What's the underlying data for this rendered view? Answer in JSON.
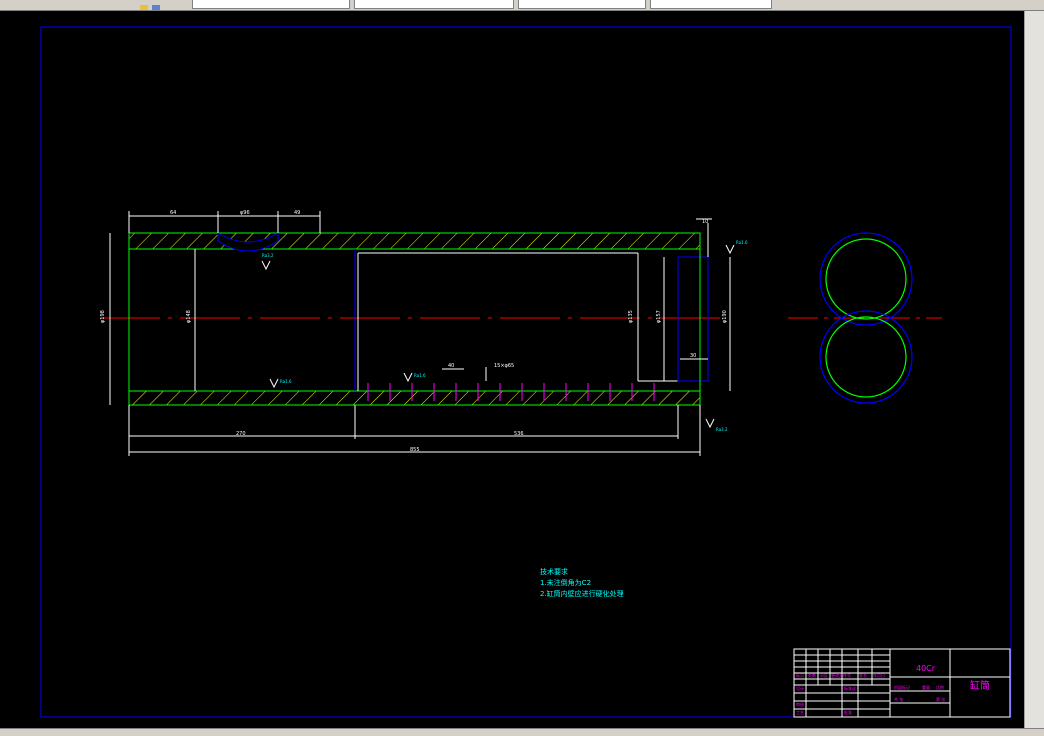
{
  "toolbar": {
    "icons": [
      "layer-state-icon",
      "layer-properties-icon"
    ],
    "dropdown_values": [
      "",
      "",
      "",
      "",
      ""
    ]
  },
  "drawing": {
    "dimensions": {
      "d_64": "64",
      "d_phi96": "φ96",
      "d_49": "49",
      "d_10": "10",
      "d_phi198": "φ198",
      "d_phi148": "φ148",
      "d_phi135_right": "φ135",
      "d_phi190": "φ190",
      "d_phi157": "φ157",
      "d_30": "30",
      "d_40": "40",
      "d_thread": "15×φ65",
      "d_270": "270",
      "d_536": "536",
      "d_855": "855"
    },
    "roughness": {
      "r1": "Ra3.2",
      "r2": "Ra1.6",
      "r3": "Ra1.6",
      "r4": "Ra1.6",
      "r5": "Ra3.2"
    },
    "notes": {
      "title": "技术要求",
      "line1": "1.未注倒角为C2",
      "line2": "2.缸筒内壁应进行硬化处理"
    },
    "title_block": {
      "material": "40Cr",
      "part_name": "缸筒",
      "header_cells": [
        "标记",
        "处数",
        "分区",
        "更改文件号",
        "签名",
        "年月日"
      ],
      "row_labels": [
        "设计",
        "标准化",
        "审核",
        "工艺",
        "批准"
      ],
      "stage_label": "阶段标记",
      "weight_label": "重量",
      "scale_label": "比例",
      "sheet_label": "共 张",
      "sheet_no": "第 张"
    },
    "colors": {
      "background": "#000000",
      "border": "#0000ff",
      "outline": "#00ff00",
      "centerline": "#ff0000",
      "hatch": "#ffff00",
      "dimension": "#ffffff",
      "text_cyan": "#00ffff",
      "text_magenta": "#ff00ff",
      "inner_line": "#0000ff"
    }
  }
}
